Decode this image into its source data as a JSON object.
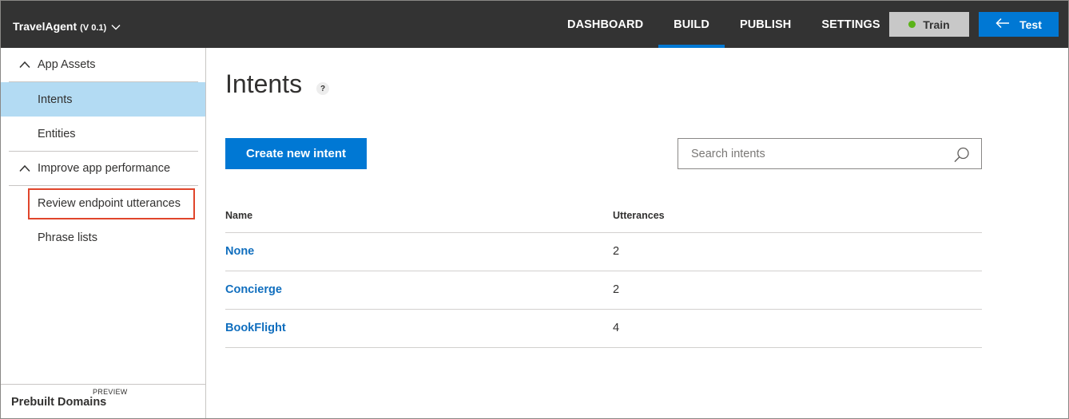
{
  "topbar": {
    "app_name": "TravelAgent",
    "app_version": "(V 0.1)",
    "nav": [
      {
        "label": "DASHBOARD",
        "active": false
      },
      {
        "label": "BUILD",
        "active": true
      },
      {
        "label": "PUBLISH",
        "active": false
      },
      {
        "label": "SETTINGS",
        "active": false
      }
    ],
    "train_label": "Train",
    "test_label": "Test",
    "train_status_color": "#5bb319",
    "accent_color": "#0078d4"
  },
  "sidebar": {
    "section_app_assets": "App Assets",
    "items_app_assets": [
      {
        "label": "Intents",
        "active": true
      },
      {
        "label": "Entities",
        "active": false
      }
    ],
    "section_improve": "Improve app performance",
    "items_improve": [
      {
        "label": "Review endpoint utterances",
        "highlighted": true
      },
      {
        "label": "Phrase lists",
        "highlighted": false
      }
    ],
    "prebuilt_label": "Prebuilt Domains",
    "prebuilt_badge": "PREVIEW"
  },
  "main": {
    "title": "Intents",
    "help_icon_text": "?",
    "create_button_label": "Create new intent",
    "search_placeholder": "Search intents",
    "search_value": "",
    "table": {
      "columns": [
        "Name",
        "Utterances"
      ],
      "rows": [
        {
          "name": "None",
          "utterances": "2"
        },
        {
          "name": "Concierge",
          "utterances": "2"
        },
        {
          "name": "BookFlight",
          "utterances": "4"
        }
      ]
    }
  }
}
